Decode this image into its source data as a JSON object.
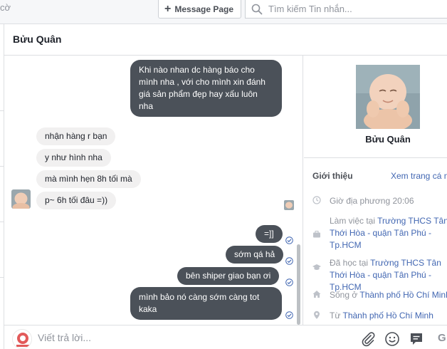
{
  "topbar": {
    "cut_text": "cờ",
    "message_page_label": "Message Page",
    "search_placeholder": "Tìm kiếm Tin nhắn..."
  },
  "chat": {
    "contact_name": "Bửu Quân",
    "messages": [
      {
        "dir": "out",
        "text": "Khi nào nhan dc hàng báo cho mình nha , với cho mình xin đánh giá sản phẩm đẹp hay xấu luôn nha"
      },
      {
        "dir": "in",
        "text": "nhận hàng r bạn"
      },
      {
        "dir": "in",
        "text": "y như hình nha"
      },
      {
        "dir": "in",
        "text": "mà mình hẹn 8h tối mà"
      },
      {
        "dir": "in",
        "text": "p~ 6h tối đâu =))"
      },
      {
        "dir": "out",
        "text": "=]]"
      },
      {
        "dir": "out",
        "text": "sớm qá hả"
      },
      {
        "dir": "out",
        "text": "bên shiper giao bạn ơi"
      },
      {
        "dir": "out",
        "text": "mình bảo nó càng sớm càng tot kaka"
      }
    ]
  },
  "composer": {
    "placeholder": "Viết trả lời...",
    "trailing_letter": "G"
  },
  "info": {
    "name": "Bửu Quân",
    "intro_label": "Giới thiệu",
    "view_page_link": "Xem trang cá n",
    "local_time": "Giờ địa phương 20:06",
    "work_prefix": "Làm việc tại ",
    "work_place": "Trường THCS Tân Thới Hòa - quận Tân Phú - Tp.HCM",
    "study_prefix": "Đã học tại ",
    "study_place": "Trường THCS Tân Thới Hòa - quận Tân Phú - Tp.HCM",
    "lives_prefix": "Sống ở ",
    "lives_place": "Thành phố Hồ Chí Minh",
    "from_prefix": "Từ ",
    "from_place": "Thành phố Hồ Chí Minh"
  },
  "colors": {
    "outgoing_bubble": "#4b5159",
    "incoming_bubble": "#f1f0f0",
    "link": "#4267b2",
    "seen_check": "#4267b2"
  },
  "icons": [
    "plus-icon",
    "search-icon",
    "seen-check-icon",
    "clock-icon",
    "briefcase-icon",
    "graduation-cap-icon",
    "home-icon",
    "location-pin-icon",
    "attach-paperclip-icon",
    "emoji-smile-icon",
    "chat-bubble-icon"
  ]
}
